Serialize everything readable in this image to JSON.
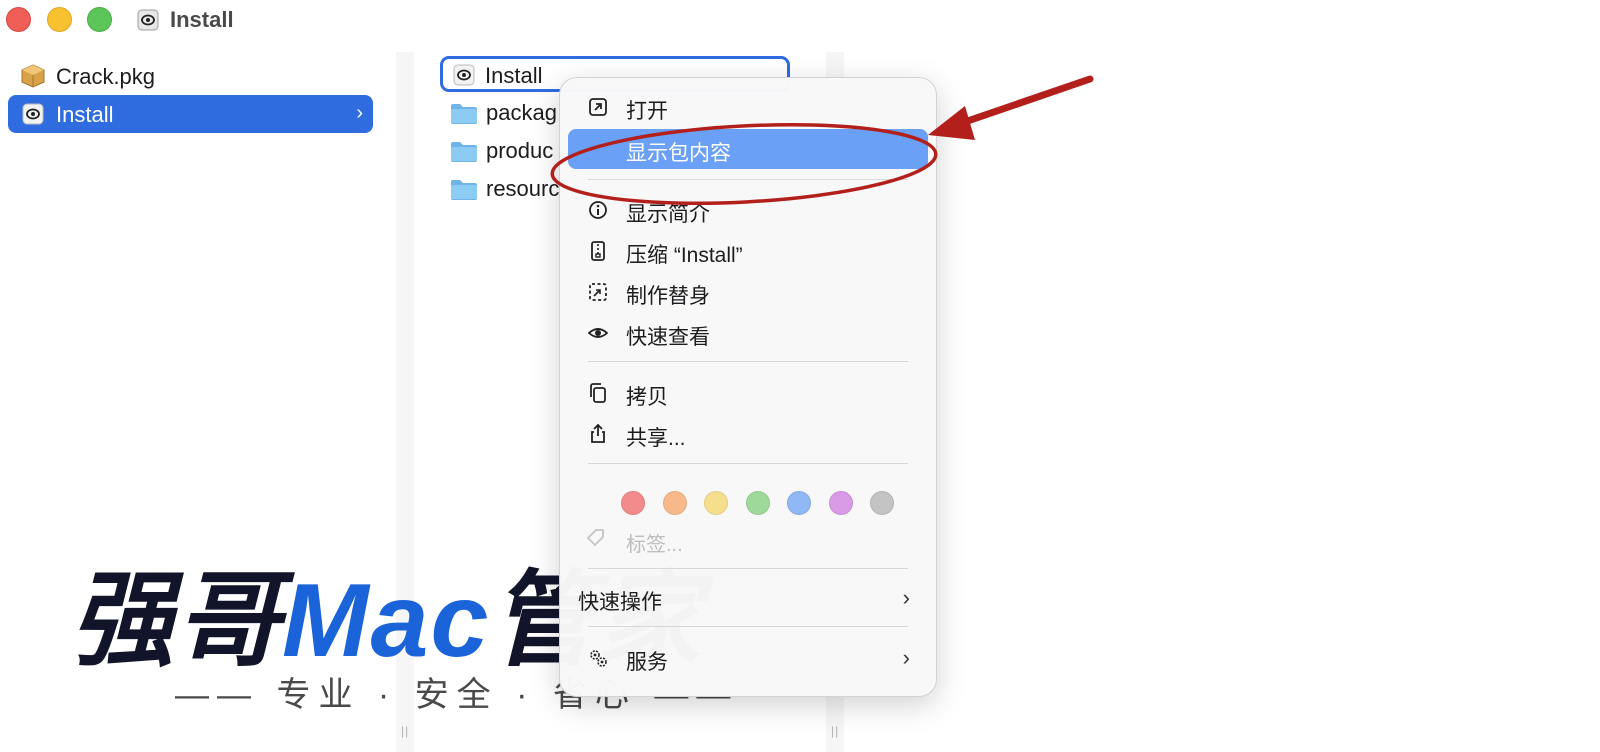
{
  "window": {
    "title": "Install"
  },
  "column1": {
    "items": [
      {
        "label": "Crack.pkg",
        "icon": "package-icon"
      },
      {
        "label": "Install",
        "icon": "app-icon",
        "selected": true
      }
    ]
  },
  "column2": {
    "items": [
      {
        "label": "Install",
        "icon": "app-icon",
        "focused": true
      },
      {
        "label": "packag",
        "icon": "folder-icon"
      },
      {
        "label": "produc",
        "icon": "folder-icon"
      },
      {
        "label": "resourc",
        "icon": "folder-icon"
      }
    ]
  },
  "context_menu": {
    "items": {
      "open": "打开",
      "show_package_contents": "显示包内容",
      "get_info": "显示简介",
      "compress": "压缩 “Install”",
      "make_alias": "制作替身",
      "quick_look": "快速查看",
      "copy": "拷贝",
      "share": "共享...",
      "tags": "标签...",
      "quick_actions": "快速操作",
      "services": "服务"
    },
    "tag_colors": [
      "#f28c8c",
      "#f7b98a",
      "#f6df8c",
      "#9fd99a",
      "#8fb8f4",
      "#d99ae6",
      "#c4c4c4"
    ]
  },
  "watermark": {
    "part1": "强哥",
    "part2": "Mac",
    "part3": "管家",
    "tagline": "—— 专业 · 安全 · 省心 ——"
  },
  "colors": {
    "accent": "#2f6ce0",
    "menu_highlight": "#6aa0f5",
    "annotation": "#b3201c"
  }
}
